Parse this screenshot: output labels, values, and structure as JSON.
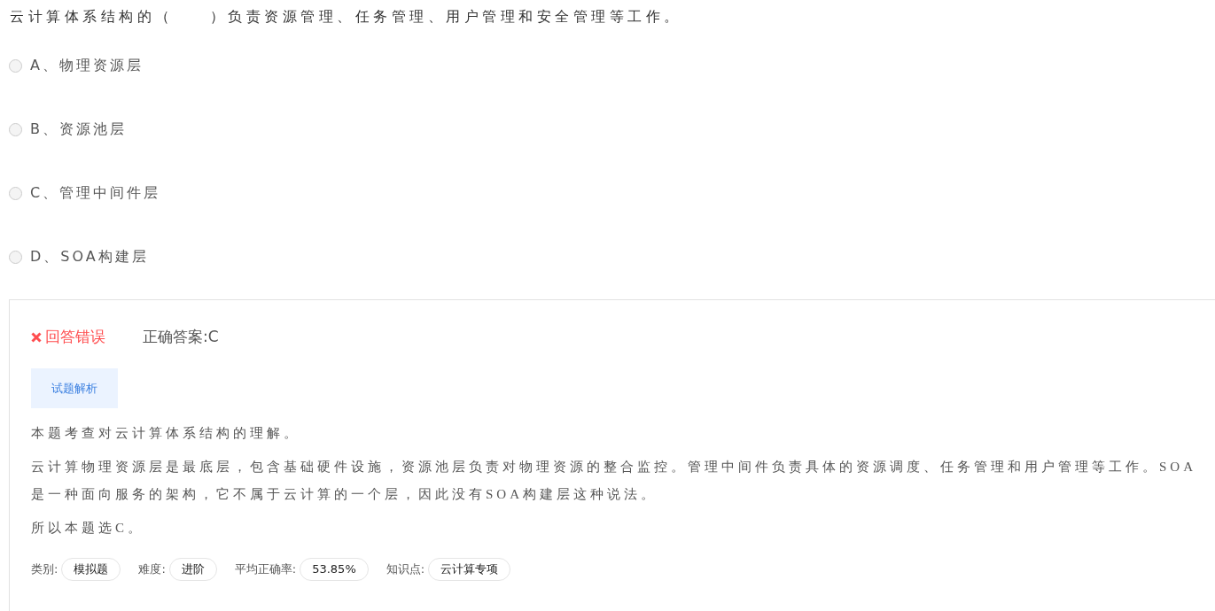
{
  "question": "云计算体系结构的（　　）负责资源管理、任务管理、用户管理和安全管理等工作。",
  "options": [
    {
      "letter": "A、",
      "text": "物理资源层",
      "selected": false
    },
    {
      "letter": "B、",
      "text": "资源池层",
      "selected": false
    },
    {
      "letter": "C、",
      "text": "管理中间件层",
      "selected": false
    },
    {
      "letter": "D、",
      "text": "SOA构建层",
      "selected": false
    }
  ],
  "result": {
    "correct": false,
    "status": "回答错误",
    "answer_label": "正确答案:",
    "answer": "C"
  },
  "analysis_tab": "试题解析",
  "analysis": [
    "本题考查对云计算体系结构的理解。",
    "云计算物理资源层是最底层，包含基础硬件设施，资源池层负责对物理资源的整合监控。管理中间件负责具体的资源调度、任务管理和用户管理等工作。SOA是一种面向服务的架构，它不属于云计算的一个层，因此没有SOA构建层这种说法。",
    "所以本题选C。"
  ],
  "meta": [
    {
      "label": "类别:",
      "value": "模拟题"
    },
    {
      "label": "难度:",
      "value": "进阶"
    },
    {
      "label": "平均正确率:",
      "value": "53.85%"
    },
    {
      "label": "知识点:",
      "value": "云计算专项"
    }
  ]
}
